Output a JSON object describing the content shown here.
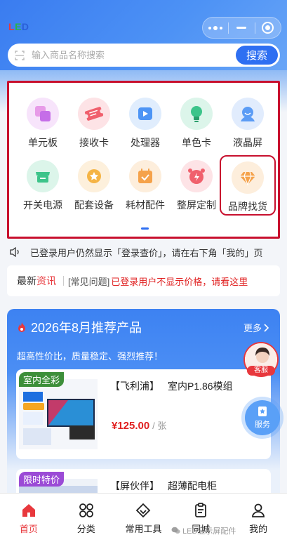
{
  "header": {
    "logo_text": "LED",
    "capsule": {
      "more_icon": "more-dots-icon",
      "minimize_icon": "minus-icon",
      "close_icon": "target-circle-icon"
    }
  },
  "search": {
    "placeholder": "输入商品名称搜索",
    "button_label": "搜索",
    "scan_icon": "scan-icon"
  },
  "categories": [
    {
      "label": "单元板",
      "icon": "unit-board-icon",
      "color": "#f7e4fb"
    },
    {
      "label": "接收卡",
      "icon": "ticket-icon",
      "color": "#fde3e6"
    },
    {
      "label": "处理器",
      "icon": "video-processor-icon",
      "color": "#e0edfd"
    },
    {
      "label": "单色卡",
      "icon": "bulb-icon",
      "color": "#dcf5ea"
    },
    {
      "label": "液晶屏",
      "icon": "lcd-face-icon",
      "color": "#e1ecfd"
    },
    {
      "label": "开关电源",
      "icon": "shop-icon",
      "color": "#dcf5ea"
    },
    {
      "label": "配套设备",
      "icon": "medal-icon",
      "color": "#fdf0dc"
    },
    {
      "label": "耗材配件",
      "icon": "calendar-check-icon",
      "color": "#fdeedc"
    },
    {
      "label": "整屏定制",
      "icon": "alarm-clock-icon",
      "color": "#fde3e6"
    },
    {
      "label": "品牌找货",
      "icon": "diamond-icon",
      "color": "#fdeedc"
    }
  ],
  "notice": {
    "text": "已登录用户仍然显示「登录查价」，请在右下角「我的」页",
    "icon": "speaker-icon"
  },
  "news": {
    "title_prefix": "最新",
    "title_highlight": "资讯",
    "tag": "[常见问题]",
    "text": "已登录用户不显示价格，请看这里"
  },
  "recommend": {
    "title": "2026年8月推荐产品",
    "more_label": "更多",
    "subtitle": "超高性价比，质量稳定、强烈推荐！",
    "products": [
      {
        "badge": "室内全彩",
        "brand": "【飞利浦】",
        "name": "室内P1.86模组",
        "price": "¥125.00",
        "unit": "/ 张"
      },
      {
        "badge": "限时特价",
        "brand": "【屏伙伴】",
        "name": "超薄配电柜"
      }
    ]
  },
  "floating": {
    "customer_service_label": "客服",
    "service_label": "服务"
  },
  "tabbar": [
    {
      "label": "首页",
      "icon": "home-icon",
      "active": true
    },
    {
      "label": "分类",
      "icon": "category-icon",
      "active": false
    },
    {
      "label": "常用工具",
      "icon": "diamond-outline-icon",
      "active": false
    },
    {
      "label": "同城",
      "icon": "clipboard-icon",
      "active": false
    },
    {
      "label": "我的",
      "icon": "user-icon",
      "active": false
    }
  ],
  "watermark": "LED显示屏配件",
  "colors": {
    "accent": "#2e6ff2",
    "highlight_border": "#c8102e",
    "price": "#e02020",
    "tab_active": "#e8383d"
  }
}
